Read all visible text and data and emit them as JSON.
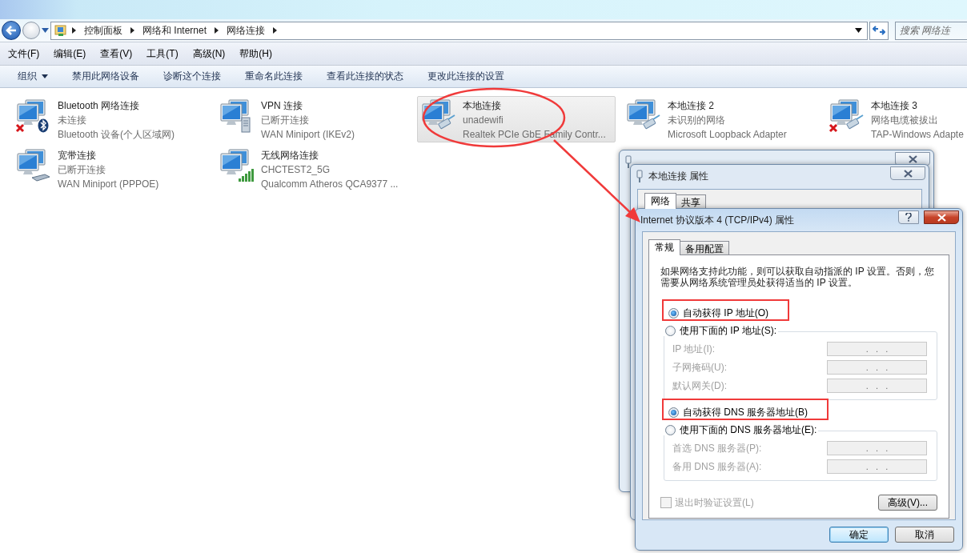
{
  "address_bar": {
    "breadcrumbs": [
      "控制面板",
      "网络和 Internet",
      "网络连接"
    ],
    "search_placeholder": "搜索 网络连"
  },
  "menu": [
    "文件(F)",
    "编辑(E)",
    "查看(V)",
    "工具(T)",
    "高级(N)",
    "帮助(H)"
  ],
  "toolbar": [
    {
      "label": "组织",
      "kind": "dropdown"
    },
    {
      "label": "禁用此网络设备",
      "kind": "button"
    },
    {
      "label": "诊断这个连接",
      "kind": "button"
    },
    {
      "label": "重命名此连接",
      "kind": "button"
    },
    {
      "label": "查看此连接的状态",
      "kind": "button"
    },
    {
      "label": "更改此连接的设置",
      "kind": "button"
    }
  ],
  "connections": [
    {
      "name": "Bluetooth 网络连接",
      "status": "未连接",
      "device": "Bluetooth 设备(个人区域网)",
      "kind": "bluetooth",
      "error": true,
      "selected": false
    },
    {
      "name": "VPN 连接",
      "status": "已断开连接",
      "device": "WAN Miniport (IKEv2)",
      "kind": "server",
      "error": false,
      "selected": false
    },
    {
      "name": "本地连接",
      "status": "unadewifi",
      "device": "Realtek PCIe GbE Family Contr...",
      "kind": "cable",
      "error": false,
      "selected": true
    },
    {
      "name": "本地连接 2",
      "status": "未识别的网络",
      "device": "Microsoft Loopback Adapter",
      "kind": "cable",
      "error": false,
      "selected": false
    },
    {
      "name": "本地连接 3",
      "status": "网络电缆被拔出",
      "device": "TAP-Windows Adapte",
      "kind": "cable",
      "error": true,
      "selected": false
    },
    {
      "name": "宽带连接",
      "status": "已断开连接",
      "device": "WAN Miniport (PPPOE)",
      "kind": "modem",
      "error": false,
      "selected": false
    },
    {
      "name": "无线网络连接",
      "status": "CHCTEST2_5G",
      "device": "Qualcomm Atheros QCA9377 ...",
      "kind": "signal",
      "error": false,
      "selected": false
    }
  ],
  "properties_dialog": {
    "title": "本地连接 属性",
    "tabs": [
      {
        "label": "网络",
        "selected": true
      },
      {
        "label": "共享",
        "selected": false
      }
    ]
  },
  "ipv4_dialog": {
    "title": "Internet 协议版本 4 (TCP/IPv4) 属性",
    "tabs": [
      {
        "label": "常规",
        "selected": true
      },
      {
        "label": "备用配置",
        "selected": false
      }
    ],
    "description": "如果网络支持此功能，则可以获取自动指派的 IP 设置。否则，您需要从网络系统管理员处获得适当的 IP 设置。",
    "ip_options": [
      {
        "label": "自动获得 IP 地址(O)",
        "selected": true,
        "highlighted": true
      },
      {
        "label": "使用下面的 IP 地址(S):",
        "selected": false,
        "highlighted": false
      }
    ],
    "ip_fields": [
      {
        "label": "IP 地址(I):",
        "value": ".   .   .",
        "disabled": true
      },
      {
        "label": "子网掩码(U):",
        "value": ".   .   .",
        "disabled": true
      },
      {
        "label": "默认网关(D):",
        "value": ".   .   .",
        "disabled": true
      }
    ],
    "dns_options": [
      {
        "label": "自动获得 DNS 服务器地址(B)",
        "selected": true,
        "highlighted": true
      },
      {
        "label": "使用下面的 DNS 服务器地址(E):",
        "selected": false,
        "highlighted": false
      }
    ],
    "dns_fields": [
      {
        "label": "首选 DNS 服务器(P):",
        "value": ".   .   .",
        "disabled": true
      },
      {
        "label": "备用 DNS 服务器(A):",
        "value": ".   .   .",
        "disabled": true
      }
    ],
    "validate_checkbox": {
      "label": "退出时验证设置(L)",
      "checked": false,
      "disabled": true
    },
    "advanced_button": "高级(V)...",
    "buttons": [
      {
        "label": "确定",
        "default": true
      },
      {
        "label": "取消",
        "default": false
      }
    ]
  }
}
